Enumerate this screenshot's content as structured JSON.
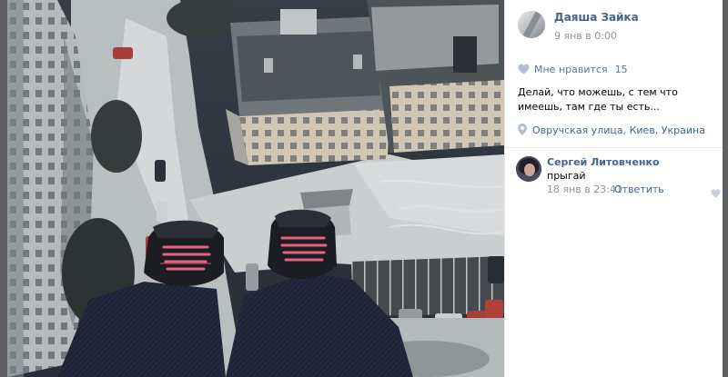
{
  "post": {
    "author_name": "Даяша Зайка",
    "date": "9 янв в 0:00",
    "likes_label": "Мне нравится",
    "likes_count": "15",
    "caption": "Делай, что можешь, с тем что имеешь, там где ты есть...",
    "location": "Овручская улица, Киев, Украина"
  },
  "comments": [
    {
      "author": "Сергей Литовченко",
      "text": "прыгай",
      "date": "18 янв в 23:41",
      "reply_label": "Ответить"
    }
  ],
  "icons": {
    "like": "heart-icon",
    "location": "map-pin-icon",
    "comment_like": "heart-icon"
  },
  "colors": {
    "link": "#42648b",
    "muted": "#939393",
    "accent_like": "#5d7391",
    "icon_gray": "#b3bfcc",
    "shoelace": "#ff6b8b"
  }
}
